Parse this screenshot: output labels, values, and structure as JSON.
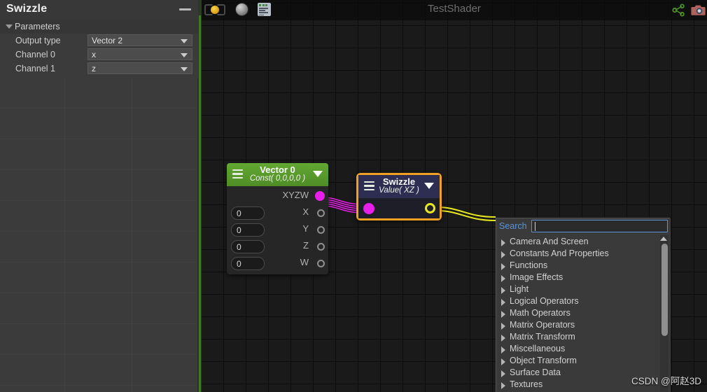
{
  "sidebar": {
    "title": "Swizzle",
    "minimize_label": "—",
    "section": {
      "label": "Parameters"
    },
    "fields": [
      {
        "label": "Output type",
        "value": "Vector 2"
      },
      {
        "label": "Channel 0",
        "value": "x"
      },
      {
        "label": "Channel 1",
        "value": "z"
      }
    ]
  },
  "toolbar": {
    "title": "TestShader",
    "icons": {
      "refresh": "refresh-icon",
      "sphere": "sphere-preview-icon",
      "code": "shader-code-icon",
      "share": "share-icon",
      "camera": "camera-icon"
    }
  },
  "graph": {
    "nodes": [
      {
        "id": "vector0",
        "title": "Vector 0",
        "subtitle": "Const( 0,0,0,0 )",
        "header_color": "#55932b",
        "ports": [
          {
            "label": "XYZW",
            "kind": "output",
            "color": "#e81fe8",
            "filled": true
          },
          {
            "label": "X",
            "kind": "output",
            "color": "#8f8f8f",
            "filled": false,
            "field": "0"
          },
          {
            "label": "Y",
            "kind": "output",
            "color": "#8f8f8f",
            "filled": false,
            "field": "0"
          },
          {
            "label": "Z",
            "kind": "output",
            "color": "#8f8f8f",
            "filled": false,
            "field": "0"
          },
          {
            "label": "W",
            "kind": "output",
            "color": "#8f8f8f",
            "filled": false,
            "field": "0"
          }
        ]
      },
      {
        "id": "swizzle",
        "title": "Swizzle",
        "subtitle": "Value( XZ )",
        "header_color": "#2e2e52",
        "selection_color": "#f0a022",
        "selected": true,
        "input_port_color": "#e81fe8",
        "output_port_color": "#e8e81f"
      }
    ],
    "wire_colors": {
      "vector_to_swizzle": "#e81fe8",
      "swizzle_out": "#e8e81f"
    }
  },
  "search_panel": {
    "label": "Search",
    "input_value": "",
    "items": [
      "Camera And Screen",
      "Constants And Properties",
      "Functions",
      "Image Effects",
      "Light",
      "Logical Operators",
      "Math Operators",
      "Matrix Operators",
      "Matrix Transform",
      "Miscellaneous",
      "Object Transform",
      "Surface Data",
      "Textures"
    ]
  },
  "watermark": "CSDN @阿赵3D"
}
